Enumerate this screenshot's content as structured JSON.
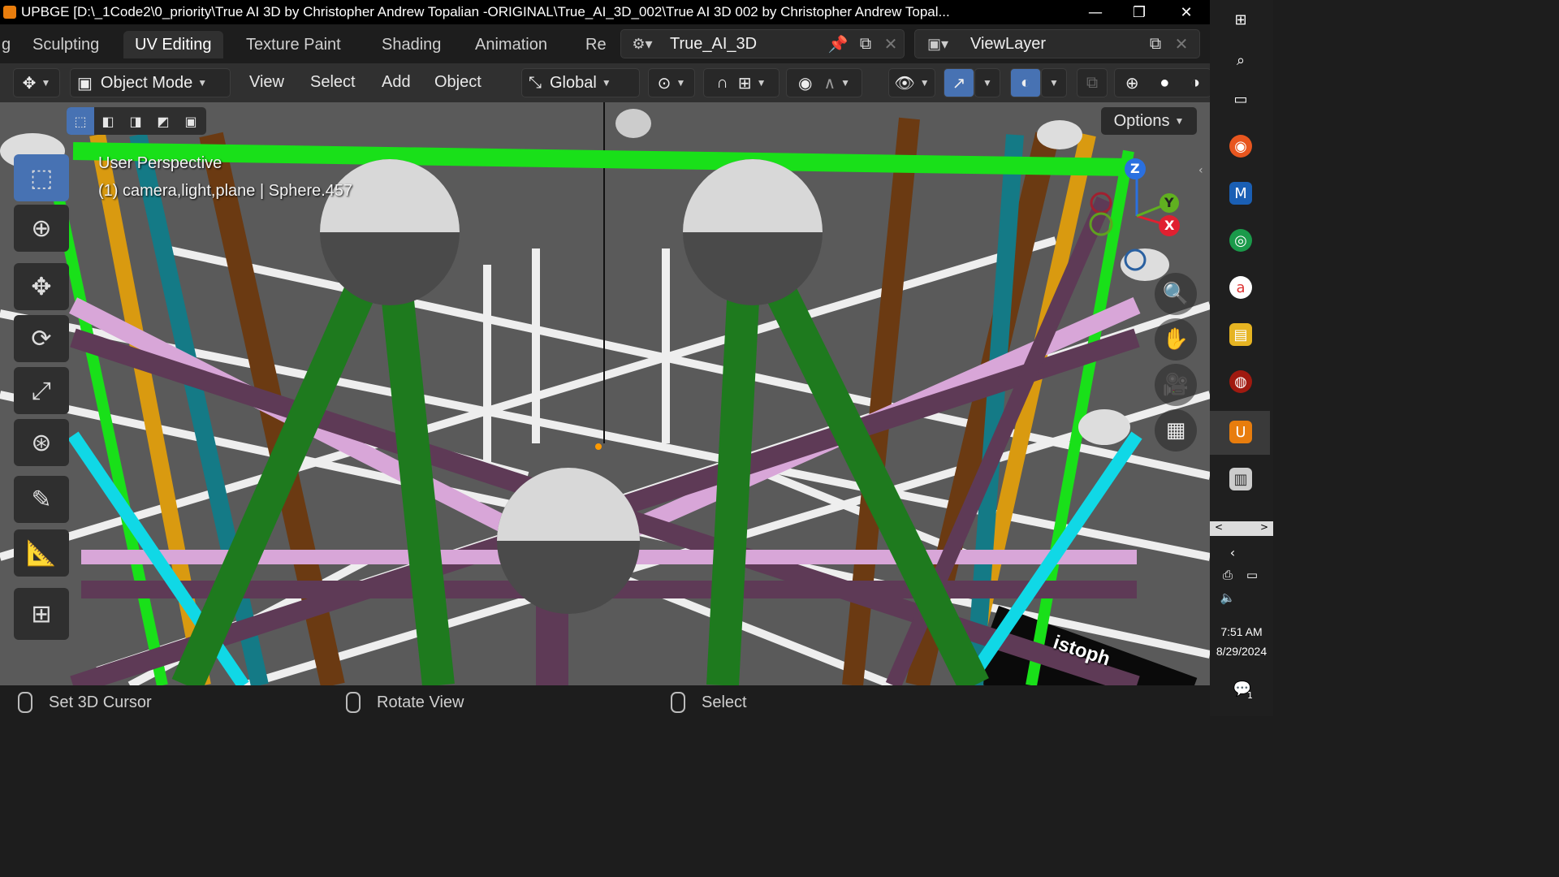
{
  "window": {
    "title": "UPBGE [D:\\_1Code2\\0_priority\\True AI 3D by Christopher Andrew Topalian -ORIGINAL\\True_AI_3D_002\\True AI 3D 002 by Christopher Andrew Topal...",
    "minimize": "—",
    "restore": "❐",
    "close": "✕"
  },
  "workspaces": {
    "cut_left": "g",
    "tabs": [
      "Sculpting",
      "UV Editing",
      "Texture Paint",
      "Shading",
      "Animation",
      "Re"
    ],
    "active": "UV Editing"
  },
  "scene_field": {
    "value": "True_AI_3D"
  },
  "viewlayer_field": {
    "value": "ViewLayer"
  },
  "header": {
    "mode": "Object Mode",
    "menus": [
      "View",
      "Select",
      "Add",
      "Object"
    ],
    "orientation": "Global",
    "options": "Options"
  },
  "viewport": {
    "perspective": "User Perspective",
    "info": "(1) camera,light,plane | Sphere.457",
    "overlay_word": "istoph",
    "axes": {
      "x": "X",
      "y": "Y",
      "z": "Z"
    },
    "colors": {
      "floor": "#5a5a5a",
      "green": "#1e7a1e",
      "bright_green": "#19e019",
      "pink": "#d8a6d8",
      "purple": "#5e3a56",
      "brown": "#6b3a12",
      "orange": "#d99a10",
      "teal": "#147a86",
      "cyan": "#10d8e6"
    }
  },
  "status": {
    "items": [
      "Set 3D Cursor",
      "Rotate View",
      "Select"
    ]
  },
  "taskbar": {
    "time": "7:51 AM",
    "date": "8/29/2024",
    "notification_count": "1"
  }
}
